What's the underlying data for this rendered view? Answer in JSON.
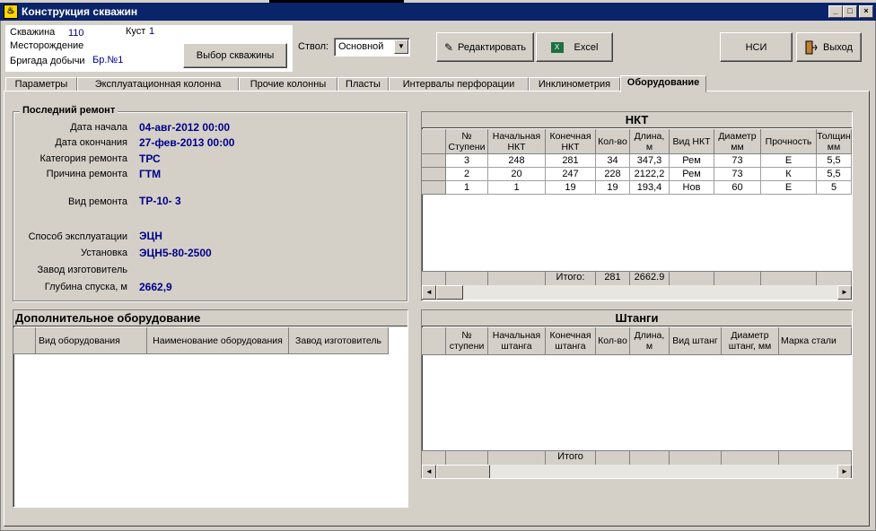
{
  "window": {
    "title": "Конструкция скважин"
  },
  "info": {
    "well_label": "Скважина",
    "well_value": "110",
    "bush_label": "Куст",
    "bush_value": "1",
    "field_label": "Месторождение",
    "brigade_label": "Бригада добычи",
    "brigade_value": "Бр.№1"
  },
  "toolbar": {
    "select_well": "Выбор скважины",
    "trunk_label": "Ствол:",
    "trunk_value": "Основной",
    "edit": "Редактировать",
    "excel": "Excel",
    "nsi": "НСИ",
    "exit": "Выход"
  },
  "tabs": [
    "Параметры",
    "Эксплуатационная колонна",
    "Прочие колонны",
    "Пласты",
    "Интервалы перфорации",
    "Инклинометрия",
    "Оборудование"
  ],
  "repair": {
    "title": "Последний ремонт",
    "fields": [
      {
        "label": "Дата начала",
        "value": "04-авг-2012 00:00"
      },
      {
        "label": "Дата окончания",
        "value": "27-фев-2013 00:00"
      },
      {
        "label": "Категория ремонта",
        "value": "ТРС"
      },
      {
        "label": "Причина ремонта",
        "value": "ГТМ"
      },
      {
        "label": "Вид ремонта",
        "value": "ТР-10- 3"
      },
      {
        "label": "Способ эксплуатации",
        "value": "ЭЦН"
      },
      {
        "label": "Установка",
        "value": "ЭЦН5-80-2500"
      },
      {
        "label": "Завод изготовитель",
        "value": ""
      },
      {
        "label": "Глубина спуска, м",
        "value": "2662,9"
      }
    ]
  },
  "extra": {
    "title": "Дополнительное оборудование",
    "columns": [
      "Вид оборудования",
      "Наименование оборудования",
      "Завод изготовитель"
    ]
  },
  "nkt": {
    "title": "НКТ",
    "columns": [
      "№ Ступени",
      "Начальная НКТ",
      "Конечная НКТ",
      "Кол-во",
      "Длина, м",
      "Вид НКТ",
      "Диаметр мм",
      "Прочность",
      "Толщин мм"
    ],
    "rows": [
      [
        "3",
        "248",
        "281",
        "34",
        "347,3",
        "Рем",
        "73",
        "Е",
        "5,5"
      ],
      [
        "2",
        "20",
        "247",
        "228",
        "2122,2",
        "Рем",
        "73",
        "К",
        "5,5"
      ],
      [
        "1",
        "1",
        "19",
        "19",
        "193,4",
        "Нов",
        "60",
        "Е",
        "5"
      ]
    ],
    "footer_label": "Итого:",
    "footer_count": "281",
    "footer_length": "2662.9"
  },
  "rods": {
    "title": "Штанги",
    "columns": [
      "№ ступени",
      "Начальная штанга",
      "Конечная штанга",
      "Кол-во",
      "Длина, м",
      "Вид штанг",
      "Диаметр штанг, мм",
      "Марка стали"
    ],
    "footer_label": "Итого"
  }
}
